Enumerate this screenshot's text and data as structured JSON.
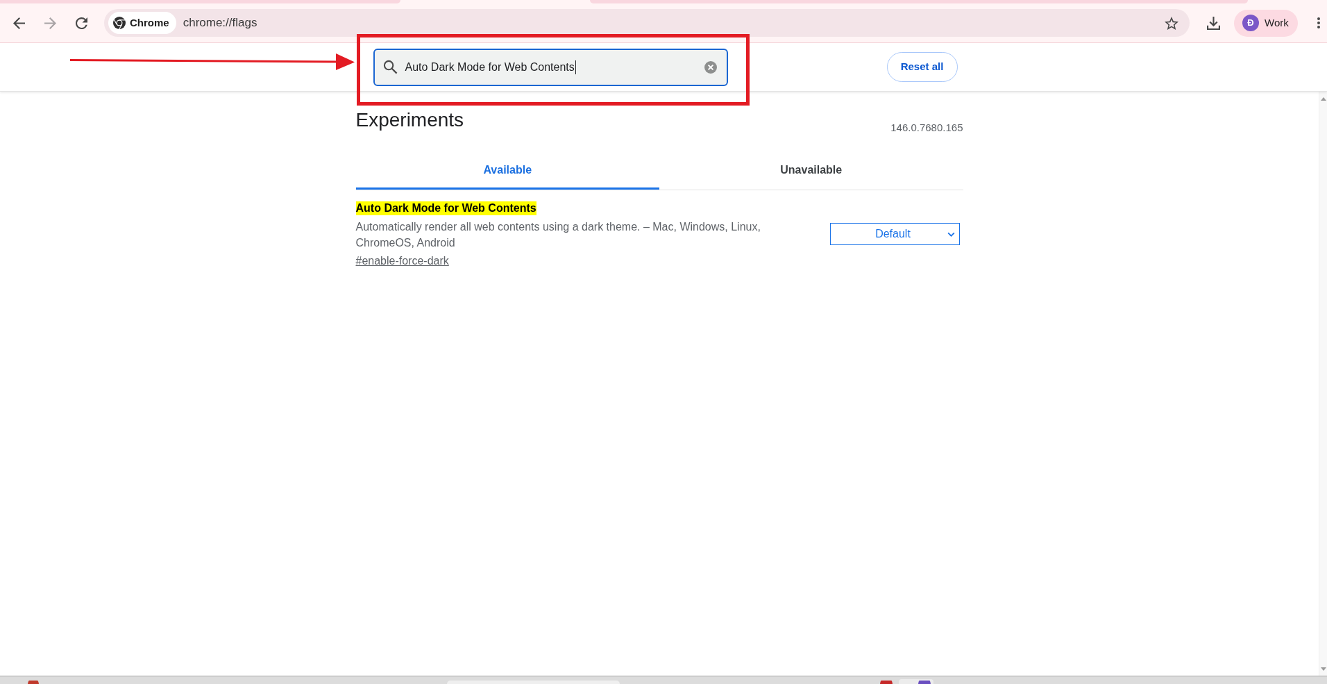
{
  "browser": {
    "nav_buttons": [
      {
        "kind": "back",
        "disabled": false
      },
      {
        "kind": "forward",
        "disabled": true
      },
      {
        "kind": "reload",
        "disabled": false
      }
    ],
    "address_bar": {
      "chip": "Chrome",
      "url": "chrome://flags"
    },
    "profile": {
      "initial": "Đ",
      "name": "Work"
    }
  },
  "header": {
    "search": {
      "value": "Auto Dark Mode for Web Contents",
      "focused": true
    },
    "reset_button": "Reset all"
  },
  "page": {
    "title": "Experiments",
    "version": "146.0.7680.165",
    "tabs": [
      {
        "label": "Available",
        "selected": true
      },
      {
        "label": "Unavailable",
        "selected": false
      }
    ],
    "flags": [
      {
        "name": "Auto Dark Mode for Web Contents",
        "highlighted": true,
        "description": "Automatically render all web contents using a dark theme. – Mac, Windows, Linux, ChromeOS, Android",
        "link": "#enable-force-dark",
        "value": "Default"
      }
    ]
  },
  "annotations": [
    {
      "kind": "highlight_frame"
    },
    {
      "kind": "arrow"
    }
  ]
}
